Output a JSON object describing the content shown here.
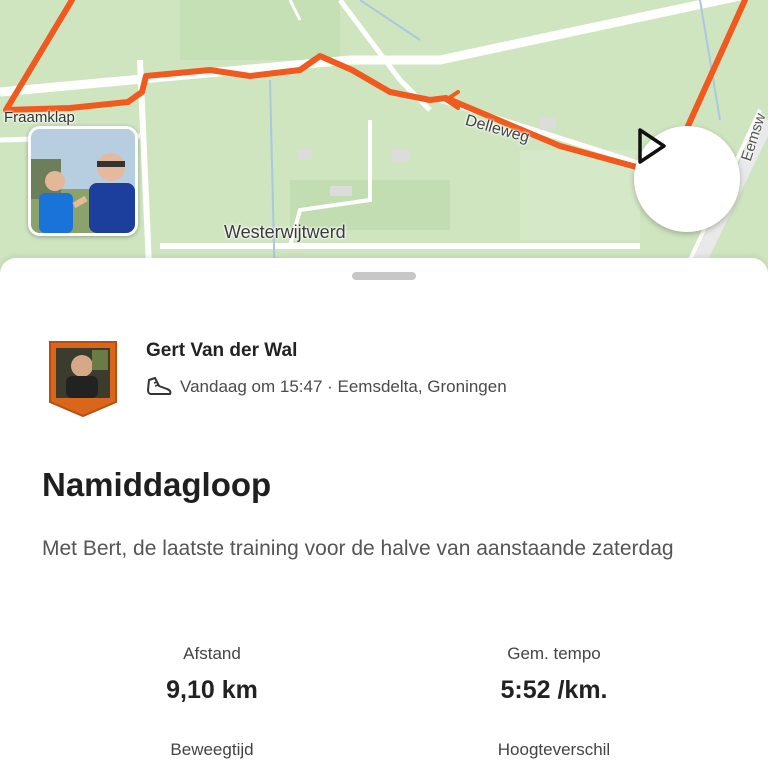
{
  "map": {
    "labels": {
      "fraamklap": "Fraamklap",
      "westerwijtwerd": "Westerwijtwerd",
      "delleweg": "Delleweg",
      "eemsweg": "Eemsw"
    },
    "route_color": "#f05a1e",
    "play_icon": "play-icon"
  },
  "activity": {
    "athlete_name": "Gert Van der Wal",
    "meta_icon": "running-shoe-icon",
    "meta": "Vandaag om 15:47 · Eemsdelta, Groningen",
    "title": "Namiddagloop",
    "description": "Met Bert, de laatste training voor de halve van aanstaande zaterdag"
  },
  "stats": [
    {
      "label": "Afstand",
      "value": "9,10 km"
    },
    {
      "label": "Gem. tempo",
      "value": "5:52 /km."
    },
    {
      "label": "Beweegtijd",
      "value": ""
    },
    {
      "label": "Hoogteverschil",
      "value": ""
    }
  ]
}
